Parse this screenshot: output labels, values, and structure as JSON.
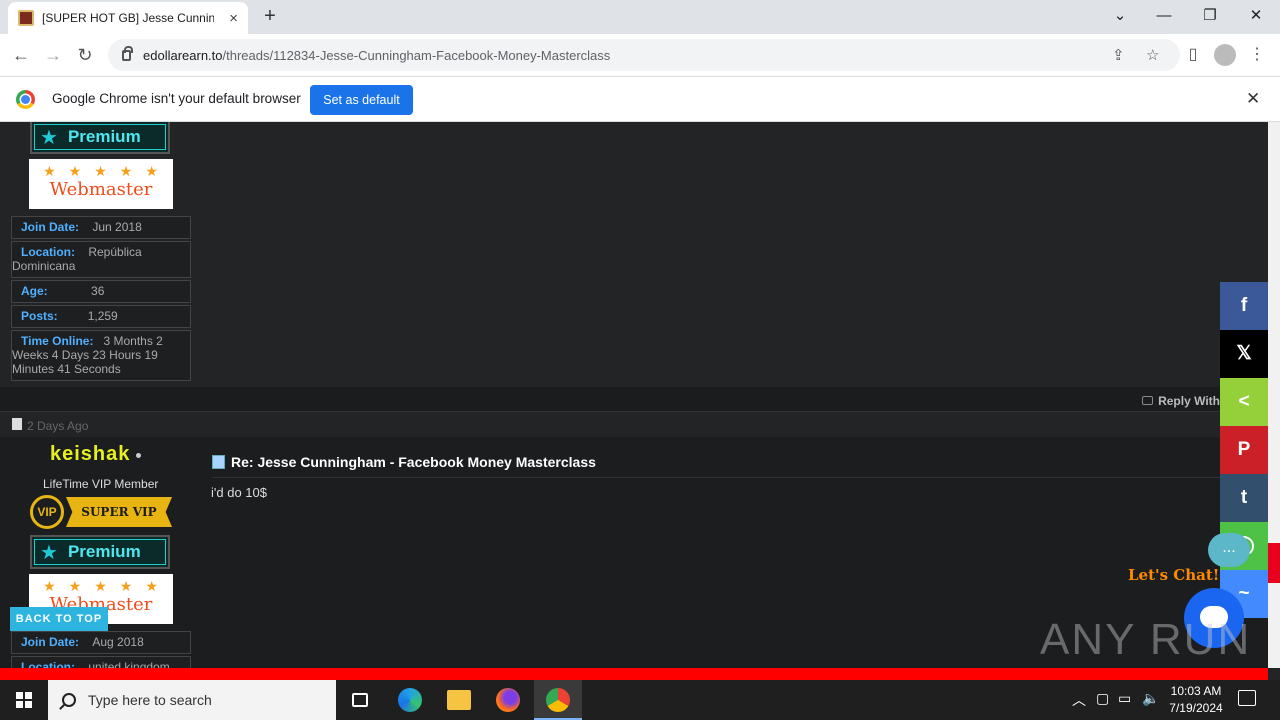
{
  "browser": {
    "tab_title": "[SUPER HOT GB] Jesse Cunningh",
    "tab_close": "×",
    "new_tab": "+",
    "url_host": "edollarearn.to",
    "url_path": "/threads/112834-Jesse-Cunningham-Facebook-Money-Masterclass",
    "window_controls": {
      "list": "⌄",
      "minimize": "—",
      "restore": "❐",
      "close": "✕"
    }
  },
  "infobar": {
    "message": "Google Chrome isn't your default browser",
    "button": "Set as default",
    "close": "✕"
  },
  "post1": {
    "badge_premium": "Premium",
    "badge_webmaster": "Webmaster",
    "join_label": "Join Date:",
    "join_value": "Jun 2018",
    "location_label": "Location:",
    "location_value": "República Dominicana",
    "age_label": "Age:",
    "age_value": "36",
    "posts_label": "Posts:",
    "posts_value": "1,259",
    "online_label": "Time Online:",
    "online_value": "3 Months 2 Weeks 4 Days 23 Hours 19 Minutes 41 Seconds",
    "reply_with": "Reply With"
  },
  "post2": {
    "date": "2 Days Ago",
    "username": "keishak",
    "usertitle": "LifeTime VIP Member",
    "vip_circle": "VIP",
    "vip_banner": "SUPER VIP",
    "badge_premium": "Premium",
    "badge_webmaster": "Webmaster",
    "join_label": "Join Date:",
    "join_value": "Aug 2018",
    "location_label": "Location:",
    "location_value": "united kingdom",
    "title": "Re: Jesse Cunningham - Facebook Money Masterclass",
    "body": "i'd do 10$"
  },
  "back_to_top": "BACK TO TOP",
  "share": [
    {
      "name": "facebook",
      "glyph": "f",
      "color": "#3b5998"
    },
    {
      "name": "x",
      "glyph": "𝕏",
      "color": "#000000"
    },
    {
      "name": "sharethis",
      "glyph": "<",
      "color": "#95d03a"
    },
    {
      "name": "pinterest",
      "glyph": "P",
      "color": "#cb2027"
    },
    {
      "name": "tumblr",
      "glyph": "t",
      "color": "#32506d"
    },
    {
      "name": "whatsapp",
      "glyph": "◯",
      "color": "#4dc247"
    },
    {
      "name": "messenger",
      "glyph": "~",
      "color": "#448aff"
    }
  ],
  "chat": {
    "bubble": "...",
    "lets_chat": "Let's Chat!"
  },
  "watermark": "ANY RUN",
  "taskbar": {
    "search_placeholder": "Type here to search",
    "time": "10:03 AM",
    "date": "7/19/2024"
  }
}
